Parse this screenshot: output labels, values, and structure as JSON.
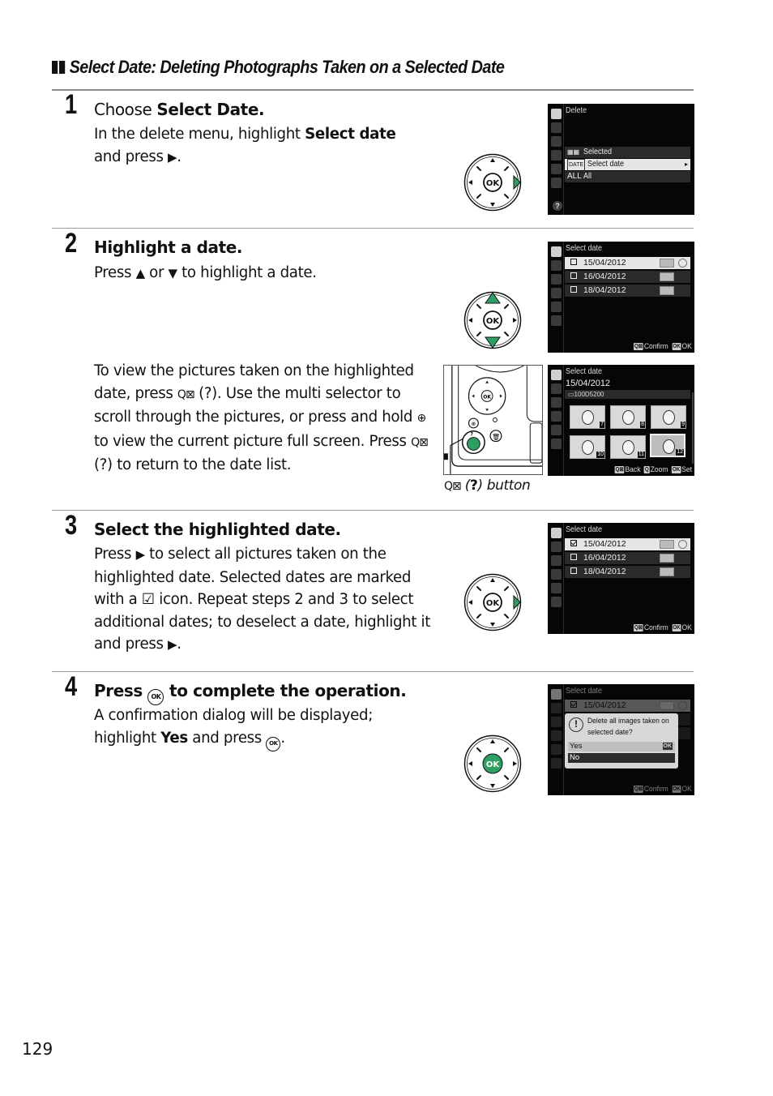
{
  "section": {
    "title": "Select Date: Deleting Photographs Taken on a Selected Date",
    "marker_icon": "double-bar-section-icon"
  },
  "steps": [
    {
      "number": "1",
      "title_prefix": "Choose ",
      "title_bold": "Select Date.",
      "body": {
        "t1": "In the delete menu, highlight ",
        "b1": "Select date",
        "t2": " and press ",
        "arrow": "▶",
        "t3": "."
      },
      "multi_selector": {
        "highlight": "right",
        "ok_highlight": false
      },
      "screen": {
        "title": "Delete",
        "items": [
          {
            "icon": "▦▦",
            "label": "Selected",
            "highlighted": false
          },
          {
            "icon": "DATE",
            "label": "Select date",
            "highlighted": true,
            "arrow": "▸"
          },
          {
            "icon": "ALL",
            "label": "All",
            "highlighted": false
          }
        ],
        "side_icons": [
          "playback-icon",
          "camera-icon",
          "pencil-icon",
          "wrench-icon",
          "retouch-icon",
          "recent-icon"
        ],
        "help": "?"
      }
    },
    {
      "number": "2",
      "title": "Highlight a date.",
      "body": {
        "t1": "Press ",
        "up": "▲",
        "t2": " or ",
        "down": "▼",
        "t3": " to highlight a date."
      },
      "multi_selector": {
        "highlight": "up-down",
        "ok_highlight": false
      },
      "screen": {
        "title": "Select date",
        "dates": [
          {
            "date": "15/04/2012",
            "checked": false,
            "highlighted": true,
            "clock": true
          },
          {
            "date": "16/04/2012",
            "checked": false,
            "highlighted": false
          },
          {
            "date": "18/04/2012",
            "checked": false,
            "highlighted": false
          }
        ],
        "footer": {
          "k1": "Q⊠",
          "confirm": "Confirm",
          "k2": "OK",
          "ok": "OK"
        }
      },
      "extra": {
        "lines": {
          "a": "To view the pictures taken on the highlighted date, press ",
          "icon1": "Q⊠",
          "q1": " (?). ",
          "b": " Use the multi selector to scroll through the pictures, or press and hold ",
          "zoomin": "⊕",
          "c": " to view the current picture full screen.  Press ",
          "icon2": "Q⊠",
          "q2": " (?)",
          "d": " to return to the date list."
        },
        "camera_caption": {
          "icon": "Q⊠",
          "paren_open": " (",
          "q": "?",
          "rest": ") button"
        },
        "thumb_screen": {
          "title": "Select date",
          "date": "15/04/2012",
          "folder": "▭100D5200",
          "thumbnails": [
            {
              "n": "7",
              "selected": false
            },
            {
              "n": "8",
              "selected": false
            },
            {
              "n": "9",
              "selected": false
            },
            {
              "n": "10",
              "selected": false
            },
            {
              "n": "11",
              "selected": false
            },
            {
              "n": "12",
              "selected": true
            }
          ],
          "footer": {
            "k1": "Q⊠",
            "back": "Back",
            "k2": "Q",
            "zoom": "Zoom",
            "k3": "OK",
            "set": "Set"
          }
        }
      }
    },
    {
      "number": "3",
      "title": "Select the highlighted date.",
      "body": {
        "t1": "Press ",
        "arrow": "▶",
        "t2": " to select all pictures taken on the highlighted date.  Selected dates are marked with a ",
        "check": "☑",
        "t3": " icon.  Repeat steps 2 and 3 to select additional dates; to deselect a date, highlight it and press ",
        "arrow2": "▶",
        "t4": "."
      },
      "multi_selector": {
        "highlight": "right",
        "ok_highlight": false
      },
      "screen": {
        "title": "Select date",
        "dates": [
          {
            "date": "15/04/2012",
            "checked": true,
            "highlighted": true,
            "clock": true
          },
          {
            "date": "16/04/2012",
            "checked": false,
            "highlighted": false
          },
          {
            "date": "18/04/2012",
            "checked": false,
            "highlighted": false
          }
        ],
        "footer": {
          "k1": "Q⊠",
          "confirm": "Confirm",
          "k2": "OK",
          "ok": "OK"
        }
      }
    },
    {
      "number": "4",
      "title_prefix": "Press ",
      "title_ok": "OK",
      "title_suffix": " to complete the operation.",
      "body": {
        "t1": "A confirmation dialog will be displayed; highlight ",
        "b1": "Yes",
        "t2": " and press ",
        "ok": "OK",
        "t3": "."
      },
      "multi_selector": {
        "highlight": "none",
        "ok_highlight": true
      },
      "screen": {
        "title": "Select date",
        "dates": [
          {
            "date": "15/04/2012",
            "checked": true,
            "highlighted": true,
            "clock": true
          }
        ],
        "dialog": {
          "icon": "!",
          "line1": "Delete all images taken on",
          "line2": "selected date?",
          "yes": "Yes",
          "yes_key": "OK",
          "no": "No",
          "highlighted": "No"
        },
        "footer": {
          "k1": "Q⊠",
          "confirm": "Confirm",
          "k2": "OK",
          "ok": "OK"
        }
      }
    }
  ],
  "colors": {
    "accent_green": "#2e9e63",
    "rule_gray": "#8c8c8c",
    "screen_bg": "#060606",
    "screen_highlight": "#e6e6e6"
  },
  "page_number": "129"
}
